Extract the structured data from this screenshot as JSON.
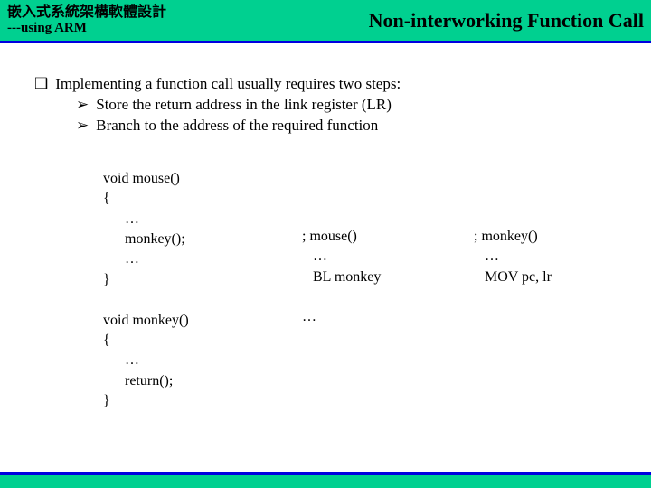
{
  "header": {
    "title_cn": "嵌入式系統架構軟體設計",
    "subtitle": "---using ARM",
    "title_right": "Non-interworking Function Call"
  },
  "bullets": {
    "mark1": "❑",
    "mark2": "➢",
    "line1": "Implementing a function call usually requires two steps:",
    "line2": "Store the return address in the link register (LR)",
    "line3": "Branch to the address of the required function"
  },
  "code": {
    "c_source": "void mouse()\n{\n      …\n      monkey();\n      …\n}\n\nvoid monkey()\n{\n      …\n      return();\n}",
    "asm_mouse": "; mouse()\n   …\n   BL monkey\n\n…",
    "asm_monkey": "; monkey()\n   …\n   MOV pc, lr"
  }
}
